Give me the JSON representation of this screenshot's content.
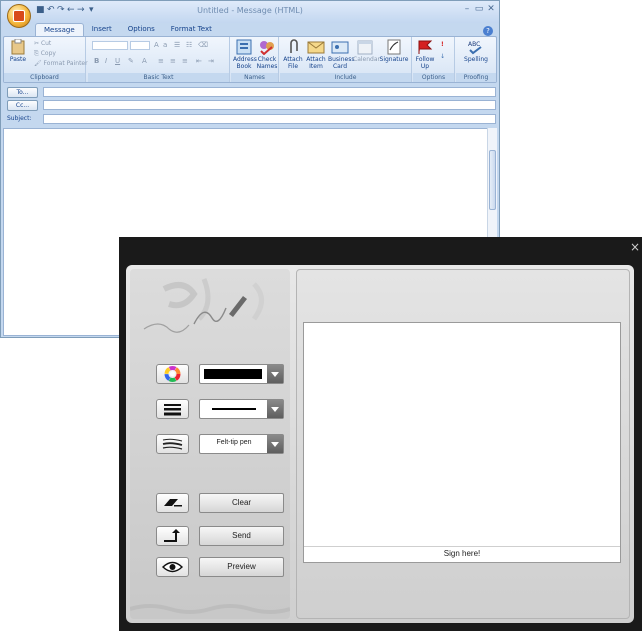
{
  "outlook": {
    "title": "Untitled - Message (HTML)",
    "tabs": [
      "Message",
      "Insert",
      "Options",
      "Format Text"
    ],
    "clipboard": {
      "paste": "Paste",
      "cut": "Cut",
      "copy": "Copy",
      "format_painter": "Format Painter",
      "label": "Clipboard"
    },
    "basic_text": {
      "label": "Basic Text",
      "bold": "B",
      "italic": "I",
      "underline": "U"
    },
    "names": {
      "address_book": "Address Book",
      "check_names": "Check Names",
      "label": "Names"
    },
    "include": {
      "attach_file": "Attach File",
      "attach_item": "Attach Item",
      "business_card": "Business Card",
      "calendar": "Calendar",
      "signature": "Signature",
      "label": "Include"
    },
    "options": {
      "follow_up": "Follow Up",
      "label": "Options"
    },
    "proofing": {
      "spelling": "Spelling",
      "label": "Proofing"
    },
    "to_label": "To...",
    "cc_label": "Cc...",
    "subject_label": "Subject:"
  },
  "dialog": {
    "pen_type": "Felt-tip pen",
    "clear": "Clear",
    "send": "Send",
    "preview": "Preview",
    "sign_here": "Sign here!",
    "close": "×",
    "pen_color": "#000000"
  }
}
